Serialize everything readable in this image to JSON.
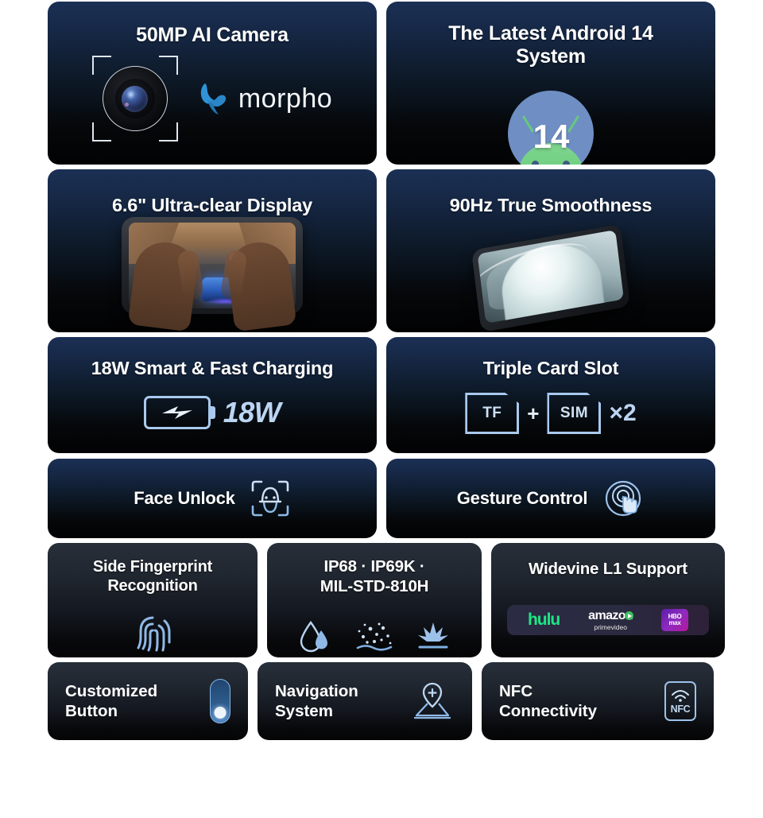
{
  "cards": {
    "camera": {
      "title": "50MP AI Camera",
      "brand_logo_text": "morpho",
      "icons": [
        "camera-lens-icon",
        "viewfinder-brackets-icon",
        "morpho-butterfly-logo"
      ]
    },
    "android": {
      "title": "The Latest Android 14 System",
      "title_line1": "The Latest Android 14",
      "title_line2": "System",
      "version_badge": "14",
      "icons": [
        "android-robot-icon"
      ]
    },
    "display": {
      "title": "6.6\" Ultra-clear Display",
      "icons": [
        "phone-landscape-gaming-image",
        "hands-holding-phone"
      ]
    },
    "refresh": {
      "title": "90Hz True Smoothness",
      "icons": [
        "phone-tilted-image"
      ]
    },
    "charging": {
      "title": "18W Smart & Fast Charging",
      "value": "18W",
      "icons": [
        "battery-bolt-icon"
      ]
    },
    "cardslot": {
      "title": "Triple Card Slot",
      "tf_label": "TF",
      "plus": "+",
      "sim_label": "SIM",
      "multiplier": "×2",
      "icons": [
        "tf-card-icon",
        "sim-card-icon"
      ]
    },
    "face_unlock": {
      "title": "Face Unlock",
      "icons": [
        "face-scan-icon"
      ]
    },
    "gesture": {
      "title": "Gesture Control",
      "icons": [
        "touch-gesture-icon"
      ]
    },
    "fingerprint": {
      "title": "Side Fingerprint Recognition",
      "title_line1": "Side Fingerprint",
      "title_line2": "Recognition",
      "icons": [
        "fingerprint-icon"
      ]
    },
    "durability": {
      "title": "IP68 · IP69K · MIL-STD-810H",
      "title_line1": "IP68 · IP69K ·",
      "title_line2": "MIL-STD-810H",
      "icons": [
        "water-drop-icon",
        "dust-particles-icon",
        "drop-impact-icon"
      ]
    },
    "widevine": {
      "title": "Widevine L1 Support",
      "services": [
        {
          "name": "hulu",
          "label": "hulu",
          "color": "#1ce783"
        },
        {
          "name": "amazon-prime-video",
          "label": "amazon",
          "sublabel": "primevideo",
          "color": "#ffffff"
        },
        {
          "name": "hbo-max",
          "label_top": "HBO",
          "label_bottom": "max",
          "color": "#8e2bbf"
        }
      ]
    },
    "custom_button": {
      "title": "Customized Button",
      "title_line1": "Customized",
      "title_line2": "Button",
      "icons": [
        "side-toggle-button-icon"
      ]
    },
    "navigation": {
      "title": "Navigation System",
      "title_line1": "Navigation",
      "title_line2": "System",
      "icons": [
        "map-pin-navigation-icon"
      ]
    },
    "nfc": {
      "title": "NFC Connectivity",
      "title_line1": "NFC",
      "title_line2": "Connectivity",
      "badge_label": "NFC",
      "icons": [
        "nfc-icon"
      ]
    }
  },
  "colors": {
    "card_blue_top": "#1b3055",
    "card_blue_bottom": "#020203",
    "card_slate_top": "#272f3a",
    "card_slate_bottom": "#050506",
    "icon_blue": "#a9c9ee",
    "text_white": "#ffffff",
    "background": "#ffffff",
    "android_green": "#63c978",
    "android_circle": "#6f8fc4",
    "morpho_blue": "#2a8fd4"
  }
}
